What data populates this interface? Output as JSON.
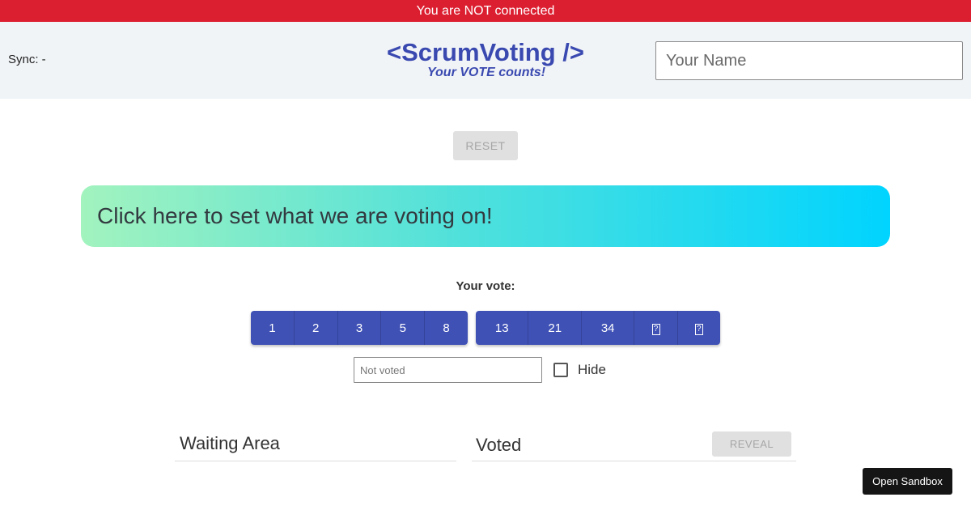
{
  "status": {
    "message": "You are NOT connected",
    "color": "#dc1f30"
  },
  "header": {
    "sync_label": "Sync: -",
    "brand_title": "<ScrumVoting />",
    "brand_tagline": "Your VOTE counts!",
    "name_placeholder": "Your Name",
    "name_value": ""
  },
  "controls": {
    "reset_label": "RESET"
  },
  "topic": {
    "prompt": "Click here to set what we are voting on!"
  },
  "vote": {
    "label": "Your vote:",
    "group_a": [
      "1",
      "2",
      "3",
      "5",
      "8"
    ],
    "group_b": [
      "13",
      "21",
      "34"
    ],
    "field_placeholder": "Not voted",
    "hide_label": "Hide",
    "hide_checked": false
  },
  "areas": {
    "waiting_title": "Waiting Area",
    "voted_title": "Voted",
    "reveal_label": "REVEAL"
  },
  "sandbox": {
    "label": "Open Sandbox"
  },
  "colors": {
    "accent": "#3f51b5",
    "brand": "#3a49b0",
    "header_bg": "#f1f4f7"
  }
}
